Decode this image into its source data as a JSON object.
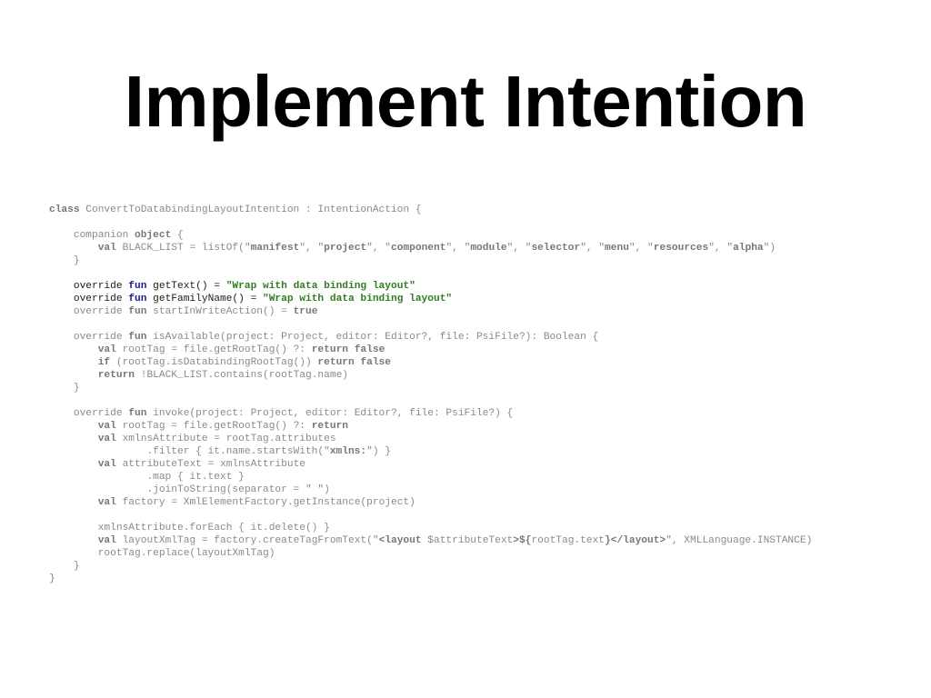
{
  "slide": {
    "title": "Implement Intention"
  },
  "code": {
    "lines": [
      [
        [
          "class",
          "kw"
        ],
        [
          " ConvertToDatabindingLayoutIntention : IntentionAction {",
          "txt"
        ]
      ],
      [],
      [
        [
          "    companion ",
          "txt"
        ],
        [
          "object",
          "kw"
        ],
        [
          " {",
          "txt"
        ]
      ],
      [
        [
          "        ",
          "txt"
        ],
        [
          "val",
          "kw"
        ],
        [
          " BLACK_LIST = listOf(\"",
          "txt"
        ],
        [
          "manifest",
          "str"
        ],
        [
          "\", \"",
          "txt"
        ],
        [
          "project",
          "str"
        ],
        [
          "\", \"",
          "txt"
        ],
        [
          "component",
          "str"
        ],
        [
          "\", \"",
          "txt"
        ],
        [
          "module",
          "str"
        ],
        [
          "\", \"",
          "txt"
        ],
        [
          "selector",
          "str"
        ],
        [
          "\", \"",
          "txt"
        ],
        [
          "menu",
          "str"
        ],
        [
          "\", \"",
          "txt"
        ],
        [
          "resources",
          "str"
        ],
        [
          "\", \"",
          "txt"
        ],
        [
          "alpha",
          "str"
        ],
        [
          "\")",
          "txt"
        ]
      ],
      [
        [
          "    }",
          "txt"
        ]
      ],
      [],
      [
        [
          "    override ",
          "dark"
        ],
        [
          "fun",
          "kwdark"
        ],
        [
          " getText() = ",
          "dark"
        ],
        [
          "\"Wrap with data binding layout\"",
          "strgreen"
        ]
      ],
      [
        [
          "    override ",
          "dark"
        ],
        [
          "fun",
          "kwdark"
        ],
        [
          " getFamilyName() = ",
          "dark"
        ],
        [
          "\"Wrap with data binding layout\"",
          "strgreen"
        ]
      ],
      [
        [
          "    override ",
          "txt"
        ],
        [
          "fun",
          "kw"
        ],
        [
          " startInWriteAction() = ",
          "txt"
        ],
        [
          "true",
          "kw"
        ]
      ],
      [],
      [
        [
          "    override ",
          "txt"
        ],
        [
          "fun",
          "kw"
        ],
        [
          " isAvailable(project: Project, editor: Editor?, file: PsiFile?): Boolean {",
          "txt"
        ]
      ],
      [
        [
          "        ",
          "txt"
        ],
        [
          "val",
          "kw"
        ],
        [
          " rootTag = file.getRootTag() ?: ",
          "txt"
        ],
        [
          "return false",
          "kw"
        ]
      ],
      [
        [
          "        ",
          "txt"
        ],
        [
          "if",
          "kw"
        ],
        [
          " (rootTag.isDatabindingRootTag()) ",
          "txt"
        ],
        [
          "return false",
          "kw"
        ]
      ],
      [
        [
          "        ",
          "txt"
        ],
        [
          "return",
          "kw"
        ],
        [
          " !BLACK_LIST.contains(rootTag.name)",
          "txt"
        ]
      ],
      [
        [
          "    }",
          "txt"
        ]
      ],
      [],
      [
        [
          "    override ",
          "txt"
        ],
        [
          "fun",
          "kw"
        ],
        [
          " invoke(project: Project, editor: Editor?, file: PsiFile?) {",
          "txt"
        ]
      ],
      [
        [
          "        ",
          "txt"
        ],
        [
          "val",
          "kw"
        ],
        [
          " rootTag = file.getRootTag() ?: ",
          "txt"
        ],
        [
          "return",
          "kw"
        ]
      ],
      [
        [
          "        ",
          "txt"
        ],
        [
          "val",
          "kw"
        ],
        [
          " xmlnsAttribute = rootTag.attributes",
          "txt"
        ]
      ],
      [
        [
          "                .filter { it.name.startsWith(\"",
          "txt"
        ],
        [
          "xmlns:",
          "str"
        ],
        [
          "\") }",
          "txt"
        ]
      ],
      [
        [
          "        ",
          "txt"
        ],
        [
          "val",
          "kw"
        ],
        [
          " attributeText = xmlnsAttribute",
          "txt"
        ]
      ],
      [
        [
          "                .map { it.text }",
          "txt"
        ]
      ],
      [
        [
          "                .joinToString(separator = \" \")",
          "txt"
        ]
      ],
      [
        [
          "        ",
          "txt"
        ],
        [
          "val",
          "kw"
        ],
        [
          " factory = XmlElementFactory.getInstance(project)",
          "txt"
        ]
      ],
      [],
      [
        [
          "        xmlnsAttribute.forEach { it.delete() }",
          "txt"
        ]
      ],
      [
        [
          "        ",
          "txt"
        ],
        [
          "val",
          "kw"
        ],
        [
          " layoutXmlTag = factory.createTagFromText(\"",
          "txt"
        ],
        [
          "<layout ",
          "str"
        ],
        [
          "$attributeText",
          "txt"
        ],
        [
          ">${",
          "str"
        ],
        [
          "rootTag.text",
          "txt"
        ],
        [
          "}</layout>",
          "str"
        ],
        [
          "\", XMLLanguage.INSTANCE)",
          "txt"
        ]
      ],
      [
        [
          "        rootTag.replace(layoutXmlTag)",
          "txt"
        ]
      ],
      [
        [
          "    }",
          "txt"
        ]
      ],
      [
        [
          "}",
          "txt"
        ]
      ]
    ]
  }
}
